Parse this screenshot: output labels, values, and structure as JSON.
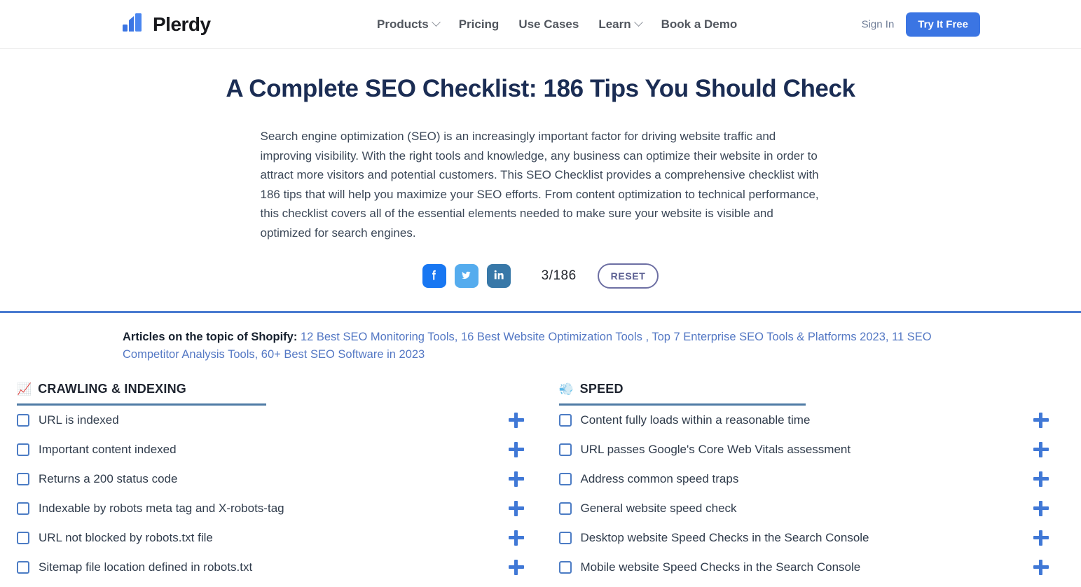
{
  "header": {
    "brand_name": "Plerdy",
    "brand_icon": "bar-chart-logo-icon",
    "flag_icon": "ukraine-flag-icon",
    "nav": [
      {
        "label": "Products",
        "has_dropdown": true
      },
      {
        "label": "Pricing",
        "has_dropdown": false
      },
      {
        "label": "Use Cases",
        "has_dropdown": false
      },
      {
        "label": "Learn",
        "has_dropdown": true
      },
      {
        "label": "Book a Demo",
        "has_dropdown": false
      }
    ],
    "sign_in": "Sign In",
    "cta": "Try It Free",
    "cta_color": "#3b75e3"
  },
  "hero": {
    "title": "A Complete SEO Checklist: 186 Tips You Should Check",
    "description": "Search engine optimization (SEO) is an increasingly important factor for driving website traffic and improving visibility. With the right tools and knowledge, any business can optimize their website in order to attract more visitors and potential customers. This SEO Checklist provides a comprehensive checklist with 186 tips that will help you maximize your SEO efforts. From content optimization to technical performance, this checklist covers all of the essential elements needed to make sure your website is visible and optimized for search engines.",
    "share": [
      {
        "name": "facebook-share-button",
        "icon": "facebook-icon",
        "color": "#1877f2"
      },
      {
        "name": "twitter-share-button",
        "icon": "twitter-icon",
        "color": "#55acee"
      },
      {
        "name": "linkedin-share-button",
        "icon": "linkedin-icon",
        "color": "#3878a8"
      }
    ],
    "counter": "3/186",
    "reset_label": "RESET",
    "divider_color": "#4a7bd0"
  },
  "articles": {
    "label": "Articles on the topic of Shopify:",
    "links": [
      "12 Best SEO Monitoring Tools,",
      "16 Best Website Optimization Tools ,",
      "Top 7 Enterprise SEO Tools & Platforms 2023,",
      "11 SEO Competitor Analysis Tools,",
      "60+ Best SEO Software in 2023"
    ]
  },
  "checklist": {
    "columns": [
      {
        "emoji": "📈",
        "emoji_name": "chart-increasing-icon",
        "title": "CRAWLING & INDEXING",
        "items": [
          "URL is indexed",
          "Important content indexed",
          "Returns a 200 status code",
          "Indexable by robots meta tag and X-robots-tag",
          "URL not blocked by robots.txt file",
          "Sitemap file location defined in robots.txt"
        ]
      },
      {
        "emoji": "💨",
        "emoji_name": "dashing-away-icon",
        "title": "SPEED",
        "items": [
          "Content fully loads within a reasonable time",
          "URL passes Google's Core Web Vitals assessment",
          "Address common speed traps",
          "General website speed check",
          "Desktop website Speed Checks in the Search Console",
          "Mobile website Speed Checks in the Search Console"
        ]
      }
    ]
  }
}
